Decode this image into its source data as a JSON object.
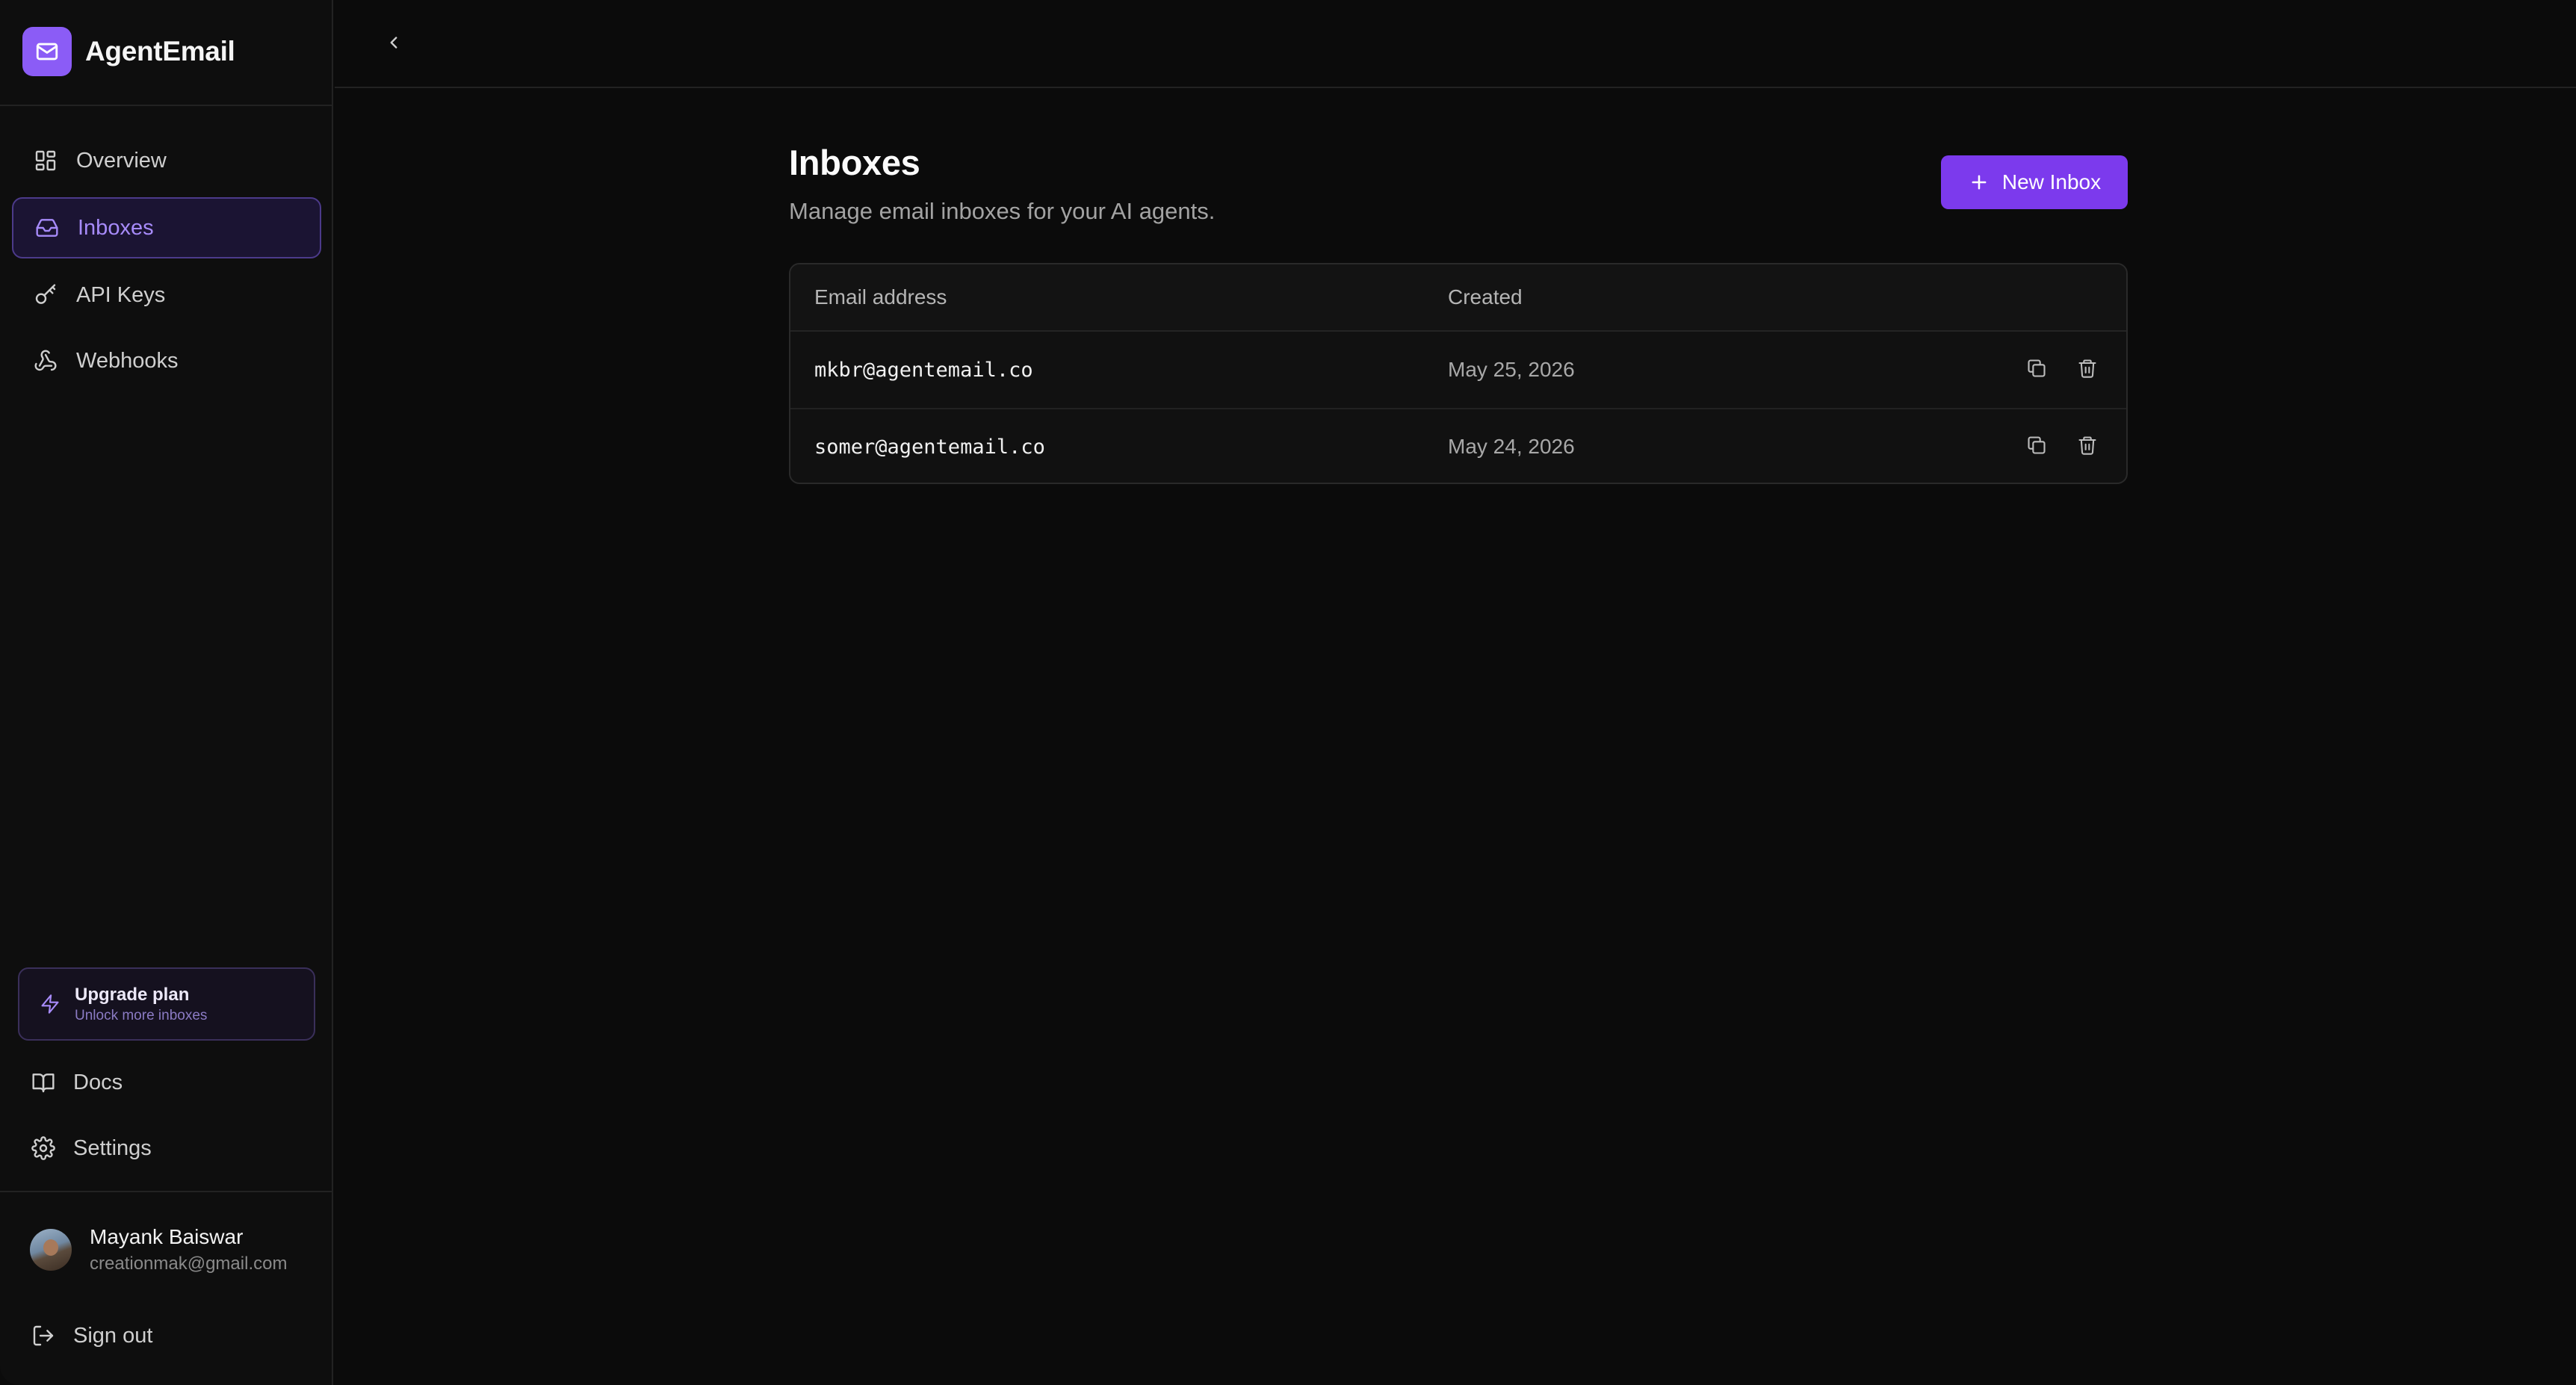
{
  "brand": {
    "name": "AgentEmail",
    "icon": "mail-icon",
    "accent": "#8b5cf6"
  },
  "sidebar": {
    "items": [
      {
        "label": "Overview",
        "icon": "layout-grid-icon",
        "active": false
      },
      {
        "label": "Inboxes",
        "icon": "inbox-icon",
        "active": true
      },
      {
        "label": "API Keys",
        "icon": "key-icon",
        "active": false
      },
      {
        "label": "Webhooks",
        "icon": "webhook-icon",
        "active": false
      }
    ],
    "upgrade": {
      "title": "Upgrade plan",
      "subtitle": "Unlock more inboxes",
      "icon": "zap-icon"
    },
    "bottom_items": [
      {
        "label": "Docs",
        "icon": "book-icon"
      },
      {
        "label": "Settings",
        "icon": "gear-icon"
      }
    ],
    "user": {
      "name": "Mayank Baiswar",
      "email": "creationmak@gmail.com"
    },
    "signout": {
      "label": "Sign out",
      "icon": "log-out-icon"
    }
  },
  "topbar": {
    "collapse_icon": "chevron-left-icon"
  },
  "main": {
    "title": "Inboxes",
    "subtitle": "Manage email inboxes for your AI agents.",
    "new_button_label": "New Inbox",
    "table": {
      "columns": [
        "Email address",
        "Created"
      ],
      "rows": [
        {
          "email": "mkbr@agentemail.co",
          "created": "May 25, 2026"
        },
        {
          "email": "somer@agentemail.co",
          "created": "May 24, 2026"
        }
      ],
      "row_actions": [
        "copy-icon",
        "trash-icon"
      ]
    }
  },
  "colors": {
    "primary_button": "#7c3aed",
    "active_nav_bg": "#1b1433",
    "active_nav_text": "#a78bfa"
  }
}
